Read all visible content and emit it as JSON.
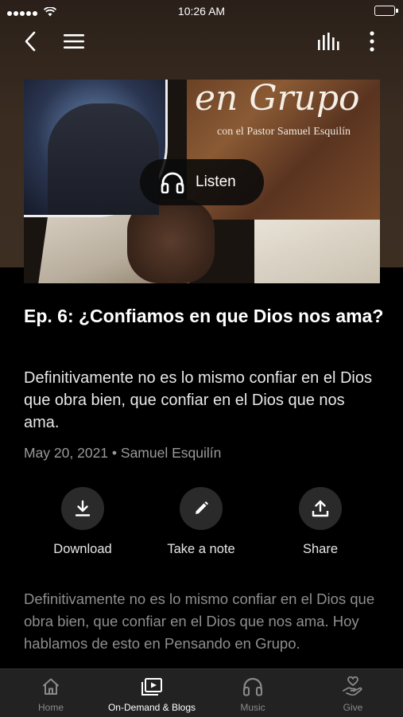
{
  "status_bar": {
    "time": "10:26 AM"
  },
  "nav": {
    "back_icon": "chevron-left-icon",
    "menu_icon": "hamburger-menu-icon",
    "audio_icon": "audio-bars-icon",
    "more_icon": "vertical-dots-icon"
  },
  "artwork": {
    "title": "en Grupo",
    "subtitle": "con el Pastor Samuel Esquilín"
  },
  "listen": {
    "label": "Listen",
    "icon": "headphones-icon"
  },
  "episode": {
    "title": "Ep. 6: ¿Confiamos en que Dios nos ama?",
    "summary": "Definitivamente no es lo mismo confiar en el Dios que obra bien, que confiar en el Dios que nos ama.",
    "meta": "May 20, 2021 • Samuel Esquilín"
  },
  "actions": [
    {
      "label": "Download",
      "icon": "download-icon"
    },
    {
      "label": "Take a note",
      "icon": "pencil-icon"
    },
    {
      "label": "Share",
      "icon": "share-icon"
    }
  ],
  "description": "Definitivamente no es lo mismo confiar en el Dios que obra bien, que confiar en el Dios que nos ama. Hoy hablamos de esto en Pensando en Grupo.",
  "tabs": [
    {
      "label": "Home",
      "icon": "home-icon",
      "active": false
    },
    {
      "label": "On-Demand & Blogs",
      "icon": "video-library-icon",
      "active": true
    },
    {
      "label": "Music",
      "icon": "headphones-icon",
      "active": false
    },
    {
      "label": "Give",
      "icon": "giving-hand-icon",
      "active": false
    }
  ],
  "colors": {
    "background": "#000000",
    "header": "#3a2c21",
    "tab_bar": "#222222",
    "muted_text": "#9a9a9a"
  }
}
